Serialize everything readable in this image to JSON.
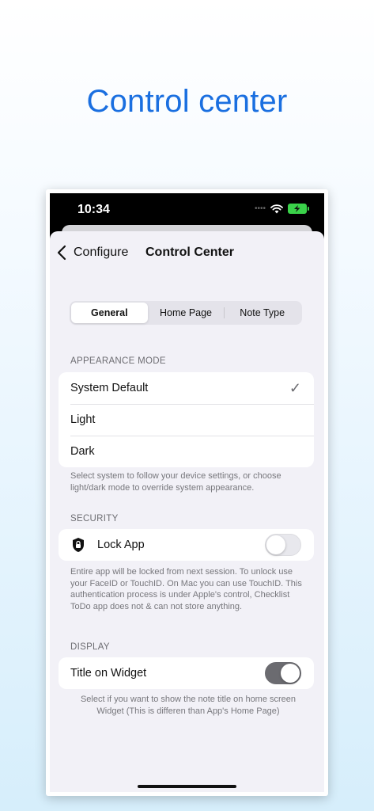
{
  "hero": {
    "title": "Control center"
  },
  "statusbar": {
    "time": "10:34",
    "dots": "•••• "
  },
  "nav": {
    "back_label": "Configure",
    "title": "Control Center"
  },
  "tabs": [
    {
      "label": "General",
      "active": true
    },
    {
      "label": "Home Page",
      "active": false
    },
    {
      "label": "Note Type",
      "active": false
    }
  ],
  "appearance": {
    "header": "APPEARANCE MODE",
    "options": [
      {
        "label": "System Default",
        "selected": true
      },
      {
        "label": "Light",
        "selected": false
      },
      {
        "label": "Dark",
        "selected": false
      }
    ],
    "check_glyph": "✓",
    "footnote": "Select system to follow your device settings, or choose light/dark mode to override system appearance."
  },
  "security": {
    "header": "SECURITY",
    "lock_label": "Lock App",
    "lock_enabled": false,
    "footnote": "Entire app will be locked from next session. To unlock use your FaceID or TouchID. On Mac you can use TouchID. This authentication process is under Apple's control, Checklist ToDo app does not & can not store anything."
  },
  "display": {
    "header": "DISPLAY",
    "widget_label": "Title on Widget",
    "widget_enabled": true,
    "footnote": "Select if you want to show the note title on home screen Widget (This is differen than App's Home Page)"
  },
  "colors": {
    "hero": "#1a6fe0",
    "battery": "#3ad24a",
    "toggle_on": "#6b6b70"
  },
  "icons": {
    "back": "chevron-left-icon",
    "lock": "shield-lock-icon",
    "wifi": "wifi-icon",
    "battery": "battery-charging-icon",
    "check": "checkmark-icon"
  }
}
